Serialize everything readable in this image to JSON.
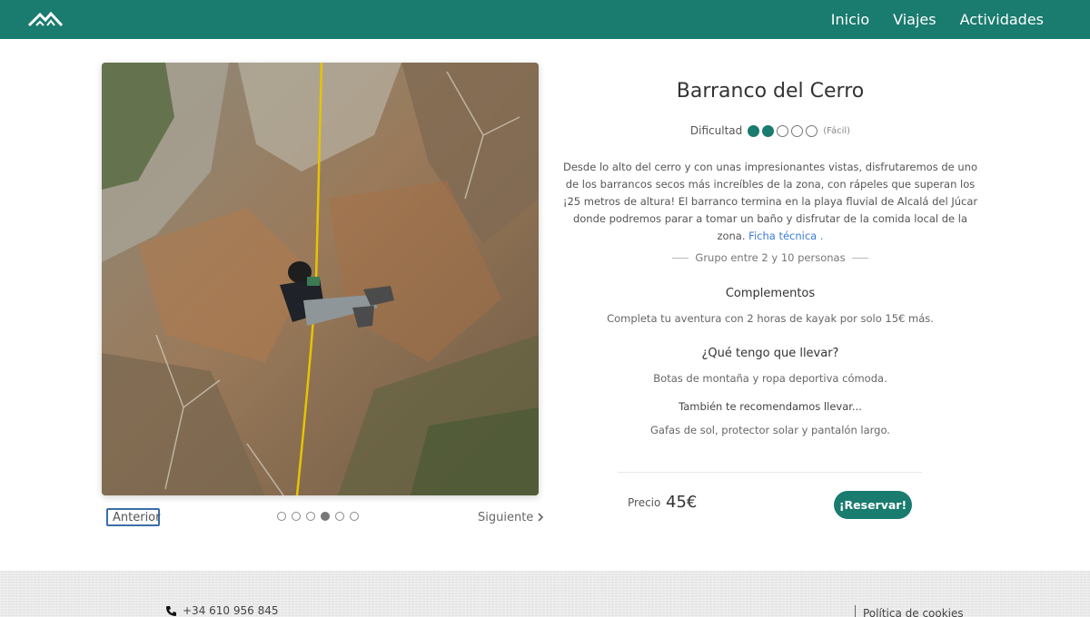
{
  "header": {
    "logo_icon": "mountain-logo-icon",
    "nav": [
      "Inicio",
      "Viajes",
      "Actividades"
    ]
  },
  "gallery": {
    "prev_label": "Anterior",
    "next_label": "Siguiente",
    "slide_count": 6,
    "active_slide": 4
  },
  "activity": {
    "title": "Barranco del Cerro",
    "difficulty_label": "Dificultad",
    "difficulty_level": 2,
    "difficulty_max": 5,
    "difficulty_note": "(Fácil)",
    "description": "Desde lo alto del cerro y con unas impresionantes vistas, disfrutaremos de uno de los barrancos secos más increíbles de la zona, con rápeles que superan los ¡25 metros de altura! El barranco termina en la playa fluvial de Alcalá del Júcar donde podremos parar a tomar un baño y disfrutar de la comida local de la zona.",
    "link_label": "Ficha técnica",
    "link_suffix": ".",
    "group": "Grupo entre 2 y 10 personas",
    "complements_title": "Complementos",
    "complements_text": "Completa tu aventura con 2 horas de kayak por solo 15€ más.",
    "bring_title": "¿Qué tengo que llevar?",
    "bring_text": "Botas de montaña y ropa deportiva cómoda.",
    "recommend_title": "También te recomendamos llevar...",
    "recommend_text": "Gafas de sol, protector solar y pantalón largo.",
    "price_label": "Precio",
    "price": "45€",
    "reserve_label": "¡Reservar!"
  },
  "footer": {
    "phone": "+34 610 956 845",
    "cookies": "Política de cookies"
  },
  "colors": {
    "brand": "#1a7b6f",
    "link": "#3b7bd4"
  }
}
